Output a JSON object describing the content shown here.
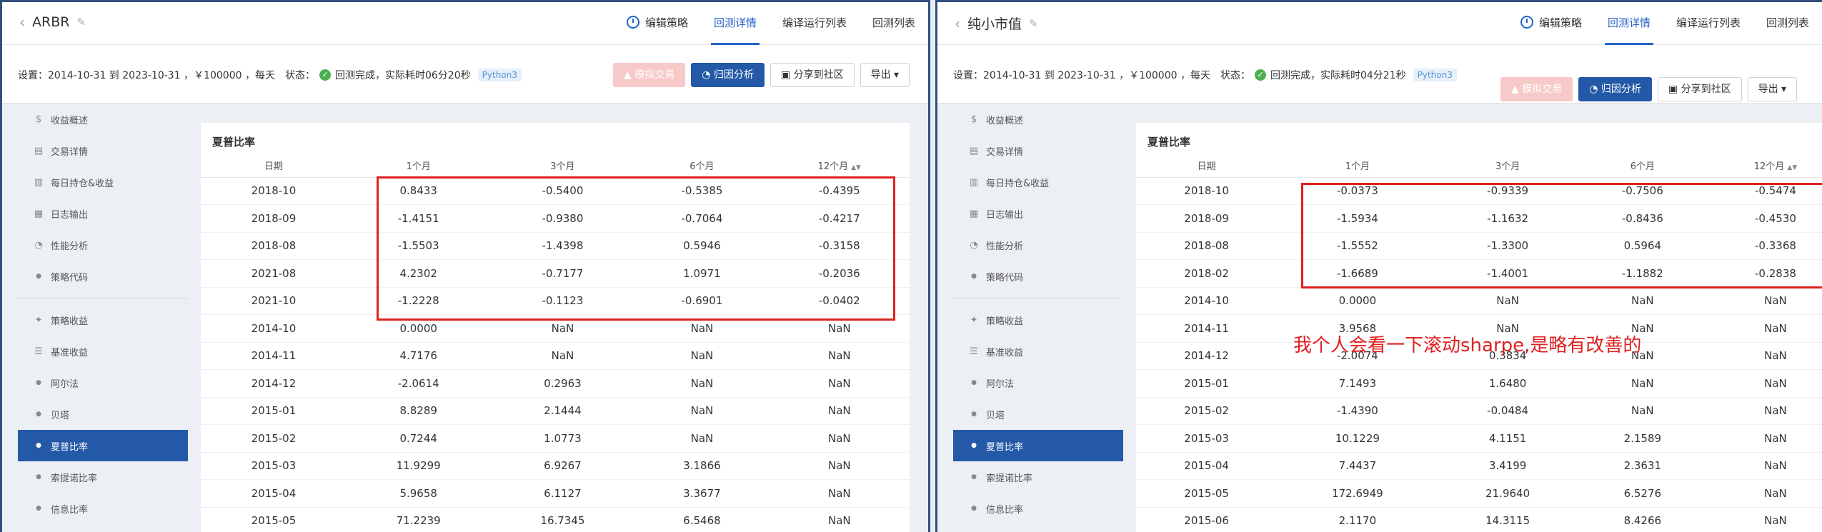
{
  "nav": {
    "items": [
      "编辑策略",
      "回测详情",
      "编译运行列表",
      "回测列表"
    ],
    "active_index": 1
  },
  "status": {
    "settings_label": "设置：",
    "state_label": "状态：",
    "complete": "回测完成",
    "python_badge": "Python3"
  },
  "buttons": {
    "simulate": "模拟交易",
    "attribution": "归因分析",
    "share": "分享到社区",
    "export": "导出"
  },
  "sidebar": [
    {
      "label": "收益概述",
      "icon": "dollar-icon",
      "sub": false
    },
    {
      "label": "交易详情",
      "icon": "document-icon",
      "sub": false
    },
    {
      "label": "每日持仓&收益",
      "icon": "bar-chart-icon",
      "sub": false
    },
    {
      "label": "日志输出",
      "icon": "calendar-icon",
      "sub": false
    },
    {
      "label": "性能分析",
      "icon": "pie-chart-icon",
      "sub": false
    },
    {
      "label": "策略代码",
      "icon": "dot-icon",
      "sub": true
    },
    {
      "divider": true
    },
    {
      "label": "策略收益",
      "icon": "bulb-icon",
      "sub": false
    },
    {
      "label": "基准收益",
      "icon": "database-icon",
      "sub": false
    },
    {
      "label": "阿尔法",
      "icon": "dot-icon",
      "sub": true
    },
    {
      "label": "贝塔",
      "icon": "dot-icon",
      "sub": true
    },
    {
      "label": "夏普比率",
      "icon": "dot-icon",
      "sub": true,
      "active": true
    },
    {
      "label": "索提诺比率",
      "icon": "dot-icon",
      "sub": true
    },
    {
      "label": "信息比率",
      "icon": "dot-icon",
      "sub": true
    }
  ],
  "table_title": "夏普比率",
  "columns": [
    "日期",
    "1个月",
    "3个月",
    "6个月",
    "12个月"
  ],
  "colors": {
    "accent": "#2459a8",
    "highlight": "#e02020"
  },
  "left": {
    "title": "ARBR",
    "settings": "2014-10-31 到 2023-10-31 ，￥100000 ，每天",
    "elapsed": "，实际耗时06分20秒",
    "rows": [
      [
        "2018-10",
        "0.8433",
        "-0.5400",
        "-0.5385",
        "-0.4395"
      ],
      [
        "2018-09",
        "-1.4151",
        "-0.9380",
        "-0.7064",
        "-0.4217"
      ],
      [
        "2018-08",
        "-1.5503",
        "-1.4398",
        "0.5946",
        "-0.3158"
      ],
      [
        "2021-08",
        "4.2302",
        "-0.7177",
        "1.0971",
        "-0.2036"
      ],
      [
        "2021-10",
        "-1.2228",
        "-0.1123",
        "-0.6901",
        "-0.0402"
      ],
      [
        "2014-10",
        "0.0000",
        "NaN",
        "NaN",
        "NaN"
      ],
      [
        "2014-11",
        "4.7176",
        "NaN",
        "NaN",
        "NaN"
      ],
      [
        "2014-12",
        "-2.0614",
        "0.2963",
        "NaN",
        "NaN"
      ],
      [
        "2015-01",
        "8.8289",
        "2.1444",
        "NaN",
        "NaN"
      ],
      [
        "2015-02",
        "0.7244",
        "1.0773",
        "NaN",
        "NaN"
      ],
      [
        "2015-03",
        "11.9299",
        "6.9267",
        "3.1866",
        "NaN"
      ],
      [
        "2015-04",
        "5.9658",
        "6.1127",
        "3.3677",
        "NaN"
      ],
      [
        "2015-05",
        "71.2239",
        "16.7345",
        "6.5468",
        "NaN"
      ]
    ]
  },
  "right": {
    "title": "纯小市值",
    "settings": "2014-10-31 到 2023-10-31 ，￥100000 ，每天",
    "elapsed": "，实际耗时04分21秒",
    "annotation": "我个人会看一下滚动sharpe,是略有改善的",
    "rows": [
      [
        "2018-10",
        "-0.0373",
        "-0.9339",
        "-0.7506",
        "-0.5474"
      ],
      [
        "2018-09",
        "-1.5934",
        "-1.1632",
        "-0.8436",
        "-0.4530"
      ],
      [
        "2018-08",
        "-1.5552",
        "-1.3300",
        "0.5964",
        "-0.3368"
      ],
      [
        "2018-02",
        "-1.6689",
        "-1.4001",
        "-1.1882",
        "-0.2838"
      ],
      [
        "2014-10",
        "0.0000",
        "NaN",
        "NaN",
        "NaN"
      ],
      [
        "2014-11",
        "3.9568",
        "NaN",
        "NaN",
        "NaN"
      ],
      [
        "2014-12",
        "-2.0074",
        "0.3834",
        "NaN",
        "NaN"
      ],
      [
        "2015-01",
        "7.1493",
        "1.6480",
        "NaN",
        "NaN"
      ],
      [
        "2015-02",
        "-1.4390",
        "-0.0484",
        "NaN",
        "NaN"
      ],
      [
        "2015-03",
        "10.1229",
        "4.1151",
        "2.1589",
        "NaN"
      ],
      [
        "2015-04",
        "7.4437",
        "3.4199",
        "2.3631",
        "NaN"
      ],
      [
        "2015-05",
        "172.6949",
        "21.9640",
        "6.5276",
        "NaN"
      ],
      [
        "2015-06",
        "2.1170",
        "14.3115",
        "8.4266",
        "NaN"
      ]
    ]
  }
}
